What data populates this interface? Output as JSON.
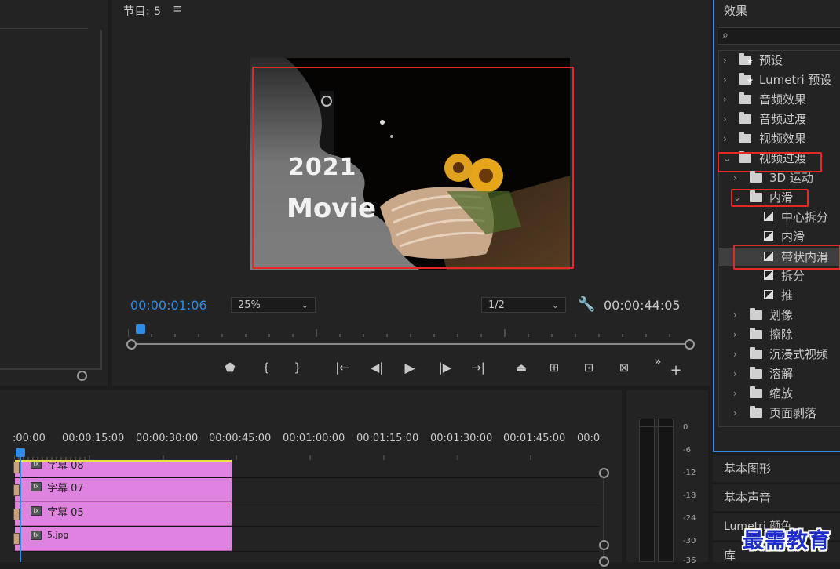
{
  "program_monitor": {
    "title": "节目: 5",
    "menu_icon": "hamburger-icon",
    "current_timecode": "00:00:01:06",
    "zoom": "25%",
    "resolution": "1/2",
    "duration": "00:00:44:05",
    "overlay_line1": "2021",
    "overlay_line2": "Movie",
    "transport_icons": [
      "marker-icon",
      "mark-in-icon",
      "mark-out-icon",
      "go-to-in-icon",
      "step-back-icon",
      "play-icon",
      "step-forward-icon",
      "go-to-out-icon",
      "lift-icon",
      "extract-icon",
      "insert-icon",
      "overwrite-icon",
      "more-icon",
      "add-button-icon"
    ]
  },
  "effects_panel": {
    "title": "效果",
    "search_placeholder": "",
    "items": [
      {
        "label": "预设",
        "icon": "star-folder-icon",
        "level": 0,
        "expanded": false
      },
      {
        "label": "Lumetri 预设",
        "icon": "star-folder-icon",
        "level": 0,
        "expanded": false
      },
      {
        "label": "音频效果",
        "icon": "folder-icon",
        "level": 0,
        "expanded": false
      },
      {
        "label": "音频过渡",
        "icon": "folder-icon",
        "level": 0,
        "expanded": false
      },
      {
        "label": "视频效果",
        "icon": "folder-icon",
        "level": 0,
        "expanded": false
      },
      {
        "label": "视频过渡",
        "icon": "folder-icon",
        "level": 0,
        "expanded": true
      },
      {
        "label": "3D 运动",
        "icon": "folder-icon",
        "level": 1,
        "expanded": false
      },
      {
        "label": "内滑",
        "icon": "folder-icon",
        "level": 1,
        "expanded": true
      },
      {
        "label": "中心拆分",
        "icon": "transition-icon",
        "level": 2
      },
      {
        "label": "内滑",
        "icon": "transition-icon",
        "level": 2
      },
      {
        "label": "带状内滑",
        "icon": "transition-icon",
        "level": 2,
        "selected": true
      },
      {
        "label": "拆分",
        "icon": "transition-icon",
        "level": 2
      },
      {
        "label": "推",
        "icon": "transition-icon",
        "level": 2
      },
      {
        "label": "划像",
        "icon": "folder-icon",
        "level": 1,
        "expanded": false
      },
      {
        "label": "擦除",
        "icon": "folder-icon",
        "level": 1,
        "expanded": false
      },
      {
        "label": "沉浸式视频",
        "icon": "folder-icon",
        "level": 1,
        "expanded": false
      },
      {
        "label": "溶解",
        "icon": "folder-icon",
        "level": 1,
        "expanded": false
      },
      {
        "label": "缩放",
        "icon": "folder-icon",
        "level": 1,
        "expanded": false
      },
      {
        "label": "页面剥落",
        "icon": "folder-icon",
        "level": 1,
        "expanded": false
      }
    ]
  },
  "side_panels": [
    "基本图形",
    "基本声音",
    "Lumetri 颜色",
    "库"
  ],
  "timeline": {
    "ruler_labels": [
      ":00:00",
      "00:00:15:00",
      "00:00:30:00",
      "00:00:45:00",
      "00:01:00:00",
      "00:01:15:00",
      "00:01:30:00",
      "00:01:45:00",
      "00:0"
    ],
    "clips": [
      {
        "label": "字幕 08",
        "badge": "fx"
      },
      {
        "label": "字幕 07",
        "badge": "fx"
      },
      {
        "label": "字幕 05",
        "badge": "fx"
      },
      {
        "label": "5.jpg",
        "badge": "fx"
      }
    ]
  },
  "audio_meter": {
    "scale": [
      "0",
      "-6",
      "-12",
      "-18",
      "-24",
      "-30",
      "-36"
    ]
  },
  "watermark": "最需教育",
  "colors": {
    "accent_blue": "#2e8ce6",
    "highlight_red": "#e52a25",
    "clip_pink": "#e082e0",
    "panel_bg": "#232323"
  }
}
